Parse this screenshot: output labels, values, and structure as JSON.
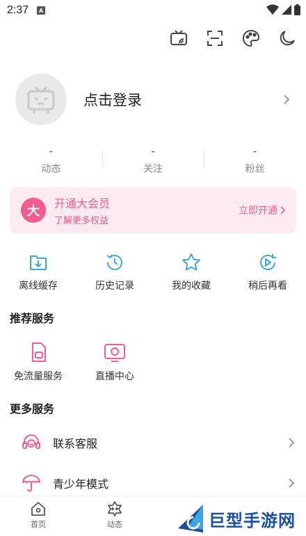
{
  "status_bar": {
    "time": "2:37",
    "badge": "A"
  },
  "profile": {
    "login_label": "点击登录"
  },
  "stats": [
    {
      "value": "-",
      "label": "动态"
    },
    {
      "value": "-",
      "label": "关注"
    },
    {
      "value": "-",
      "label": "粉丝"
    }
  ],
  "vip": {
    "logo": "大",
    "title": "开通大会员",
    "subtitle": "了解更多权益",
    "button": "立即开通"
  },
  "quick_actions": [
    {
      "label": "离线缓存",
      "icon": "download-icon"
    },
    {
      "label": "历史记录",
      "icon": "history-icon"
    },
    {
      "label": "我的收藏",
      "icon": "star-icon"
    },
    {
      "label": "稍后再看",
      "icon": "watch-later-icon"
    }
  ],
  "recommended": {
    "title": "推荐服务",
    "items": [
      {
        "label": "免流量服务",
        "icon": "sim-card-icon"
      },
      {
        "label": "直播中心",
        "icon": "live-tv-icon"
      }
    ]
  },
  "more": {
    "title": "更多服务",
    "items": [
      {
        "label": "联系客服",
        "icon": "headset-icon"
      },
      {
        "label": "青少年模式",
        "icon": "umbrella-icon"
      }
    ]
  },
  "bottom_nav": [
    {
      "label": "首页",
      "icon": "home-icon"
    },
    {
      "label": "动态",
      "icon": "activity-icon"
    }
  ],
  "watermark": {
    "text": "巨型手游网"
  },
  "colors": {
    "accent_blue": "#3fa7e0",
    "accent_pink": "#f25d8e",
    "vip_bg": "#fdebf0"
  }
}
